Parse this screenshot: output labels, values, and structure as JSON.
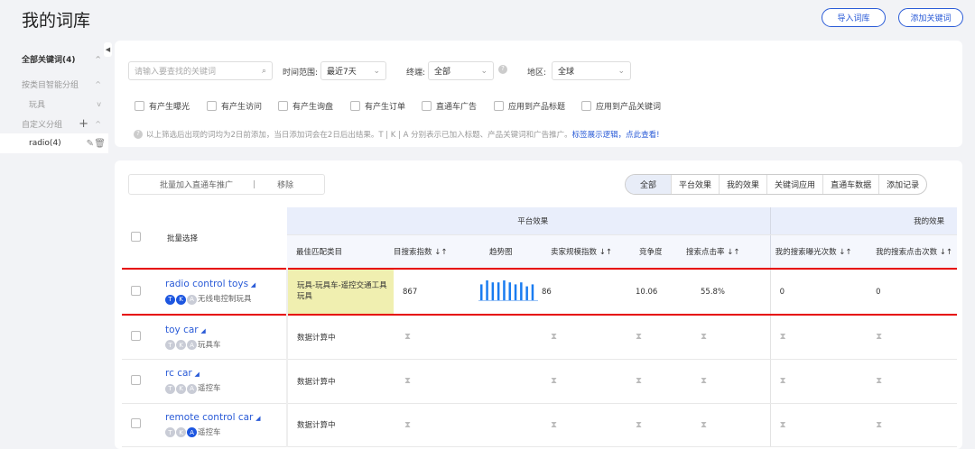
{
  "header": {
    "title": "我的词库",
    "import_label": "导入词库",
    "add_label": "添加关键词"
  },
  "sidebar": {
    "all": "全部关键词(4)",
    "by_category": "按类目智能分组",
    "toys": "玩具",
    "custom": "自定义分组",
    "radio": "radio(4)"
  },
  "filters": {
    "search_placeholder": "请输入要查找的关键词",
    "time_label": "时间范围:",
    "time_value": "最近7天",
    "terminal_label": "终端:",
    "terminal_value": "全部",
    "region_label": "地区:",
    "region_value": "全球",
    "checks": [
      "有产生曝光",
      "有产生访问",
      "有产生询盘",
      "有产生订单",
      "直通车广告",
      "应用到产品标题",
      "应用到产品关键词"
    ],
    "note": "以上筛选后出现的词均为2日前添加，当日添加词会在2日后出结果。T | K | A 分别表示已加入标题、产品关键词和广告推广。",
    "note_link": "标签展示逻辑，点此查看!"
  },
  "toolbar": {
    "batch_add": "批量加入直通车推广",
    "sep": "|",
    "remove": "移除",
    "tabs": [
      "全部",
      "平台效果",
      "我的效果",
      "关键词应用",
      "直通车数据",
      "添加记录"
    ]
  },
  "table": {
    "batch_select": "批量选择",
    "group_platform": "平台效果",
    "group_mine": "我的效果",
    "columns": [
      "最佳匹配类目",
      "目搜索指数 ↓↑",
      "趋势图",
      "卖家规模指数 ↓↑",
      "竞争度",
      "搜索点击率 ↓↑",
      "我的搜索曝光次数 ↓↑",
      "我的搜索点击次数 ↓↑"
    ],
    "rows": [
      {
        "keyword": "radio control toys",
        "tags": [
          "T",
          "K",
          "A"
        ],
        "tags_on": [
          true,
          true,
          false
        ],
        "group": "无线电控制玩具",
        "category": "玩具-玩具车-遥控交通工具玩具",
        "search_index": "867",
        "seller_index": "86",
        "competition": "10.06",
        "ctr": "55.8%",
        "my_impr": "0",
        "my_clicks": "0",
        "trend": [
          8,
          10,
          9,
          9,
          10,
          9,
          8,
          9,
          7,
          8
        ]
      },
      {
        "keyword": "toy car",
        "tags": [
          "T",
          "K",
          "A"
        ],
        "tags_on": [
          false,
          false,
          false
        ],
        "group": "玩具车",
        "category": "数据计算中"
      },
      {
        "keyword": "rc car",
        "tags": [
          "T",
          "K",
          "A"
        ],
        "tags_on": [
          false,
          false,
          false
        ],
        "group": "遥控车",
        "category": "数据计算中"
      },
      {
        "keyword": "remote control car",
        "tags": [
          "T",
          "K",
          "A"
        ],
        "tags_on": [
          false,
          false,
          true
        ],
        "group": "遥控车",
        "category": "数据计算中"
      }
    ]
  },
  "colors": {
    "accent": "#2a5bd7",
    "highlight": "#f0efb0",
    "red": "#e60000"
  }
}
